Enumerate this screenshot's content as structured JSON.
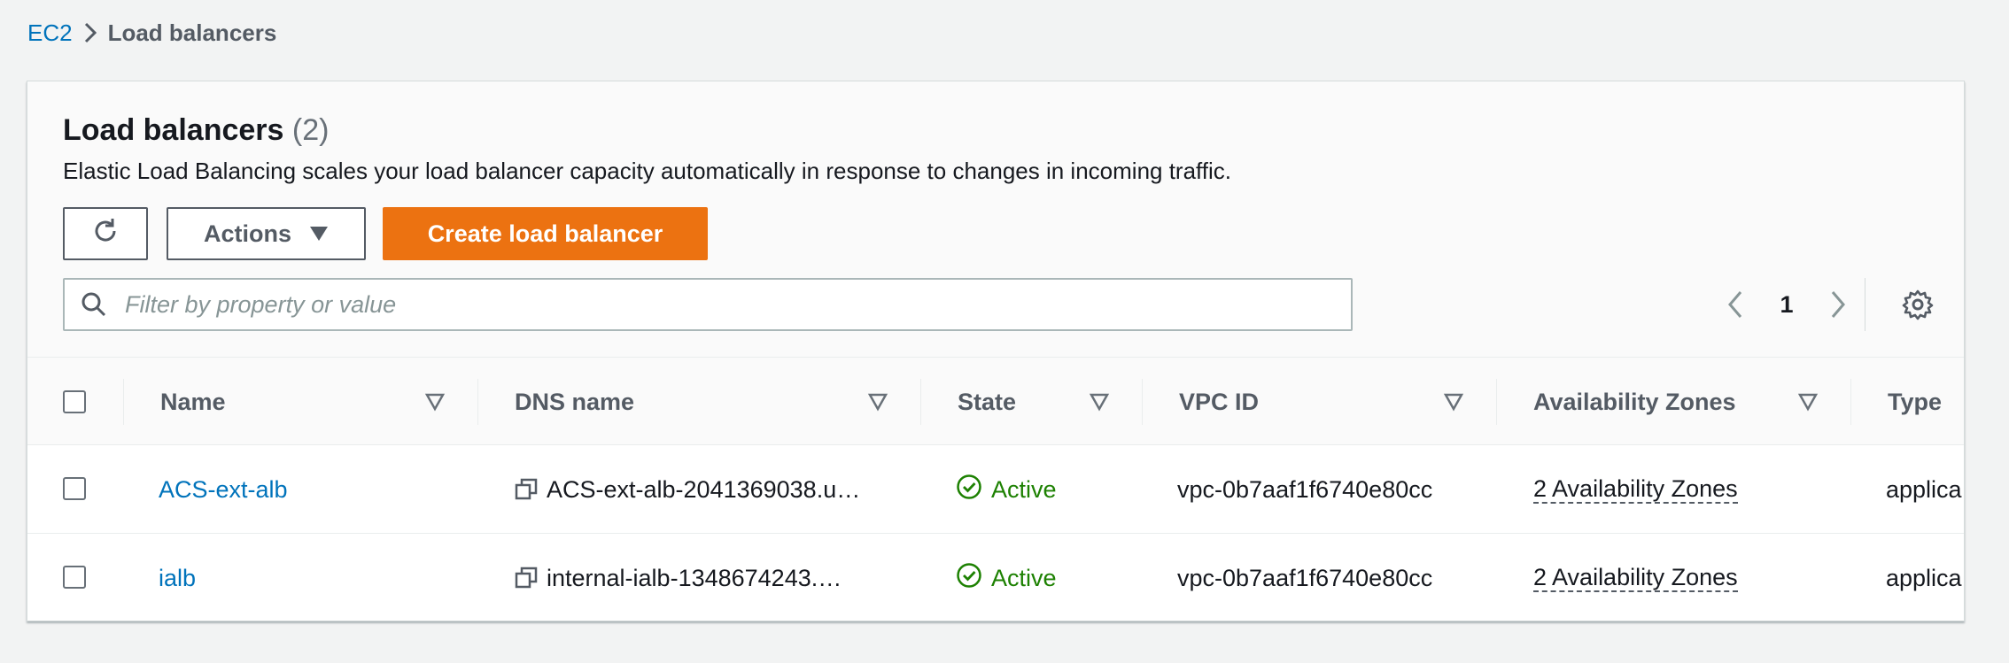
{
  "breadcrumb": {
    "root": "EC2",
    "current": "Load balancers"
  },
  "header": {
    "title": "Load balancers",
    "count": "(2)",
    "description": "Elastic Load Balancing scales your load balancer capacity automatically in response to changes in incoming traffic."
  },
  "toolbar": {
    "refresh_icon": "refresh-icon",
    "actions_label": "Actions",
    "create_label": "Create load balancer"
  },
  "filter": {
    "placeholder": "Filter by property or value",
    "value": ""
  },
  "pagination": {
    "current_page": "1"
  },
  "table": {
    "columns": [
      "Name",
      "DNS name",
      "State",
      "VPC ID",
      "Availability Zones",
      "Type"
    ],
    "rows": [
      {
        "name": "ACS-ext-alb",
        "dns": "ACS-ext-alb-2041369038.u…",
        "state": "Active",
        "vpc": "vpc-0b7aaf1f6740e80cc",
        "az": "2 Availability Zones",
        "type": "applica"
      },
      {
        "name": "ialb",
        "dns": "internal-ialb-1348674243.…",
        "state": "Active",
        "vpc": "vpc-0b7aaf1f6740e80cc",
        "az": "2 Availability Zones",
        "type": "applica"
      }
    ]
  },
  "colors": {
    "link": "#0073bb",
    "primary": "#ec7211",
    "success": "#1d8102",
    "background": "#f2f3f3"
  }
}
